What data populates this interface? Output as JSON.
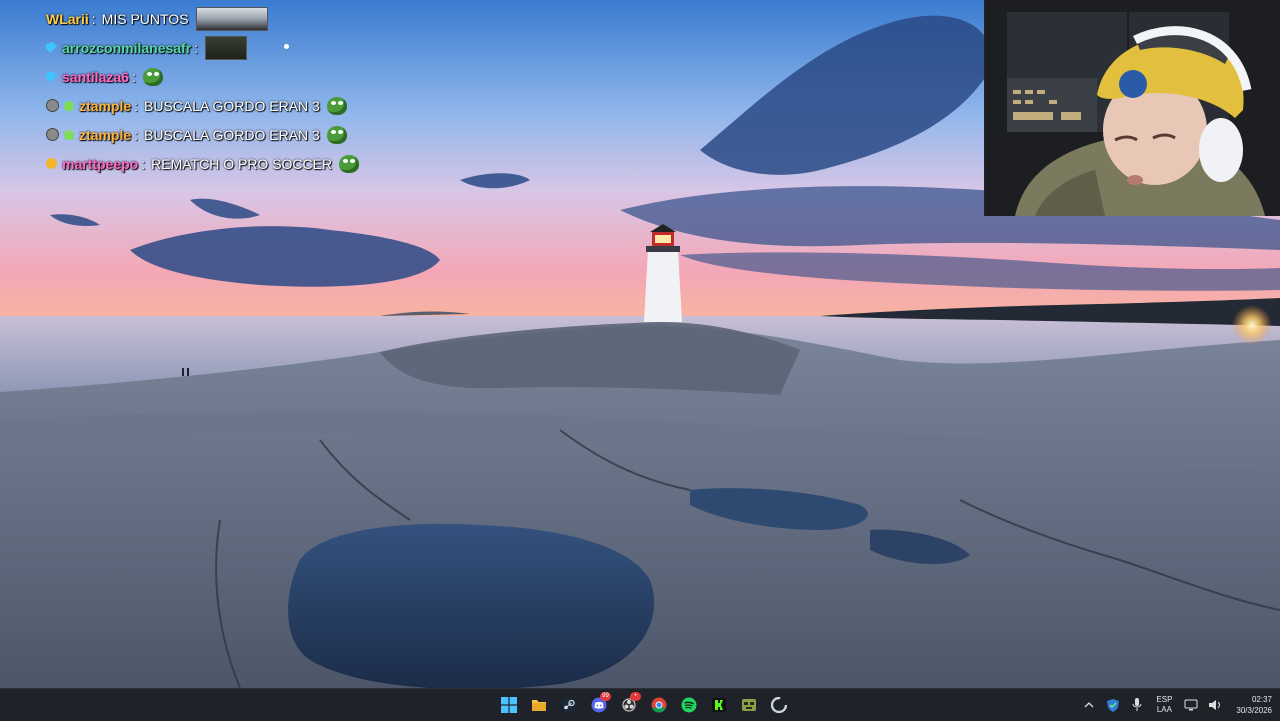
{
  "chat": [
    {
      "badges": [],
      "user": "WLarii",
      "user_color": "#ffcf4a",
      "message": "MIS PUNTOS",
      "emote": "image"
    },
    {
      "badges": [
        "blue"
      ],
      "user": "arrozconmilanesafr",
      "user_color": "#56d9a6",
      "message": "",
      "emote": "image-small"
    },
    {
      "badges": [
        "blue"
      ],
      "user": "santilaza6",
      "user_color": "#ff69c8",
      "message": "",
      "emote": "pepe"
    },
    {
      "badges": [
        "grey",
        "alien"
      ],
      "user": "ztample",
      "user_color": "#ffb640",
      "message": "BUSCALA GORDO ERAN 3",
      "emote": "pepe"
    },
    {
      "badges": [
        "grey",
        "alien"
      ],
      "user": "ztample",
      "user_color": "#ffb640",
      "message": "BUSCALA GORDO ERAN 3",
      "emote": "pepe"
    },
    {
      "badges": [
        "gold"
      ],
      "user": "marttpeepo",
      "user_color": "#ff69c8",
      "message": "REMATCH O PRO SOCCER",
      "emote": "pepe"
    }
  ],
  "taskbar": {
    "apps": [
      {
        "name": "start-icon",
        "color": "#4cc2ff"
      },
      {
        "name": "file-explorer-icon",
        "color": "#f6c544"
      },
      {
        "name": "steam-icon",
        "color": "#d9e6f2"
      },
      {
        "name": "discord-icon",
        "color": "#5865f2",
        "badge": "99"
      },
      {
        "name": "obs-icon",
        "color": "#d8d8d8",
        "badge": "•"
      },
      {
        "name": "chrome-icon",
        "color": "#4285f4"
      },
      {
        "name": "spotify-icon",
        "color": "#1ed760"
      },
      {
        "name": "kick-icon",
        "color": "#53fc18"
      },
      {
        "name": "game-icon",
        "color": "#8aa04a"
      },
      {
        "name": "ccleaner-icon",
        "color": "#c9d6e2"
      }
    ],
    "lang_top": "ESP",
    "lang_bottom": "LAA",
    "time": "02:37",
    "date": "30/3/2026"
  },
  "colors": {
    "taskbar_bg": "#1f2229",
    "sky_top": "#3f7fd1",
    "sky_horizon": "#f4a6b6"
  }
}
